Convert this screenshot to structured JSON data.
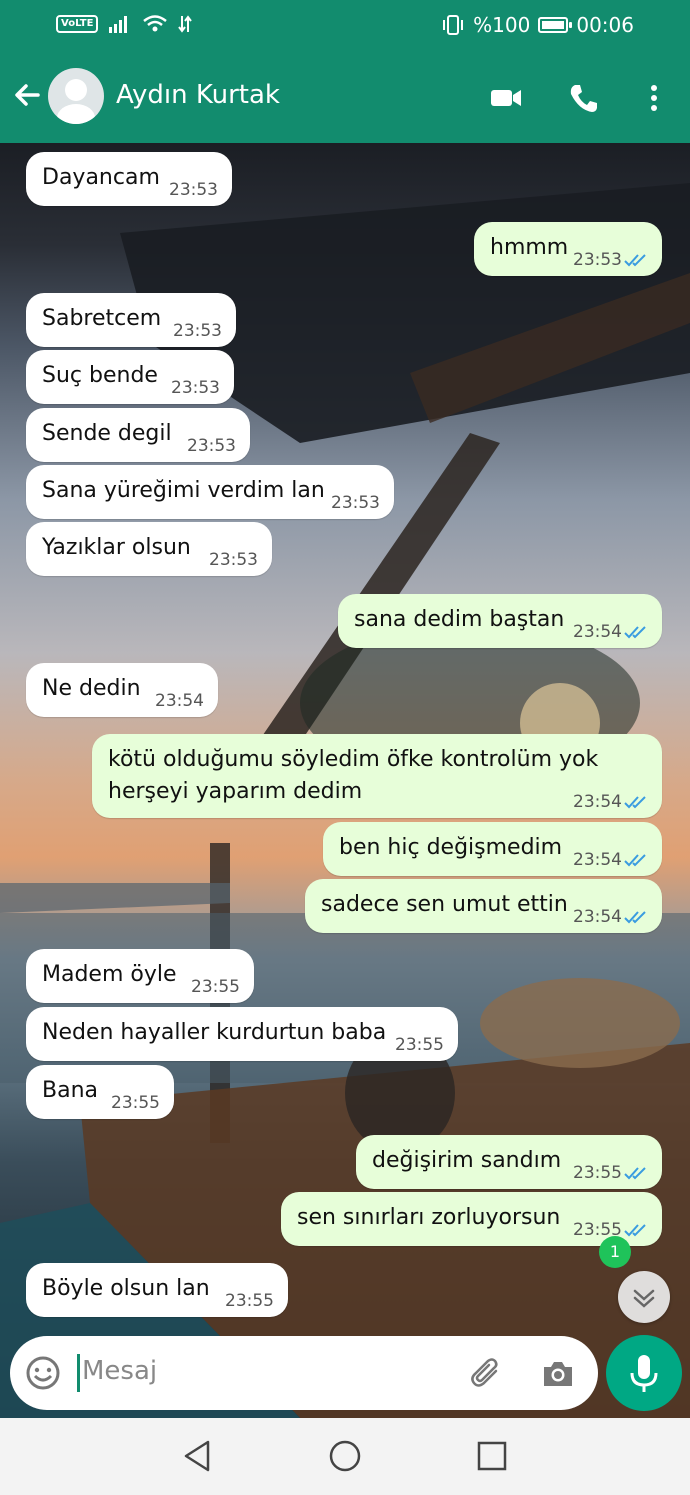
{
  "status": {
    "volte": "VoLTE",
    "battery_text": "%100",
    "battery_level": 1.0,
    "time": "00:06"
  },
  "header": {
    "contact_name": "Aydın Kurtak"
  },
  "messages": [
    {
      "dir": "in",
      "text": "Dayancam",
      "time": "23:53"
    },
    {
      "dir": "out",
      "text": "hmmm",
      "time": "23:53"
    },
    {
      "dir": "in",
      "text": "Sabretcem",
      "time": "23:53"
    },
    {
      "dir": "in",
      "text": "Suç bende",
      "time": "23:53"
    },
    {
      "dir": "in",
      "text": "Sende degil",
      "time": "23:53"
    },
    {
      "dir": "in",
      "text": "Sana yüreğimi verdim lan",
      "time": "23:53"
    },
    {
      "dir": "in",
      "text": "Yazıklar olsun",
      "time": "23:53"
    },
    {
      "dir": "out",
      "text": "sana dedim baştan",
      "time": "23:54"
    },
    {
      "dir": "in",
      "text": "Ne dedin",
      "time": "23:54"
    },
    {
      "dir": "out",
      "text": "kötü olduğumu söyledim öfke kontrolüm yok",
      "text2": "herşeyi yaparım dedim",
      "time": "23:54"
    },
    {
      "dir": "out",
      "text": "ben hiç değişmedim",
      "time": "23:54"
    },
    {
      "dir": "out",
      "text": "sadece sen umut ettin",
      "time": "23:54"
    },
    {
      "dir": "in",
      "text": "Madem öyle",
      "time": "23:55"
    },
    {
      "dir": "in",
      "text": "Neden hayaller kurdurtun baba",
      "time": "23:55"
    },
    {
      "dir": "in",
      "text": "Bana",
      "time": "23:55"
    },
    {
      "dir": "out",
      "text": "değişirim sandım",
      "time": "23:55"
    },
    {
      "dir": "out",
      "text": "sen sınırları zorluyorsun",
      "time": "23:55"
    },
    {
      "dir": "in",
      "text": "Böyle olsun lan",
      "time": "23:55"
    }
  ],
  "unread_badge": "1",
  "input": {
    "placeholder": "Mesaj"
  },
  "colors": {
    "header": "#128c6e",
    "outgoing_bubble": "#e7fed9",
    "incoming_bubble": "#ffffff",
    "mic_button": "#00a884",
    "read_ticks": "#3a9ce0"
  },
  "icons": [
    "back-arrow-icon",
    "avatar-icon",
    "video-call-icon",
    "phone-icon",
    "more-icon",
    "emoji-icon",
    "attach-icon",
    "camera-icon",
    "mic-icon",
    "chevron-down-icon",
    "nav-back-icon",
    "nav-home-icon",
    "nav-recents-icon"
  ]
}
